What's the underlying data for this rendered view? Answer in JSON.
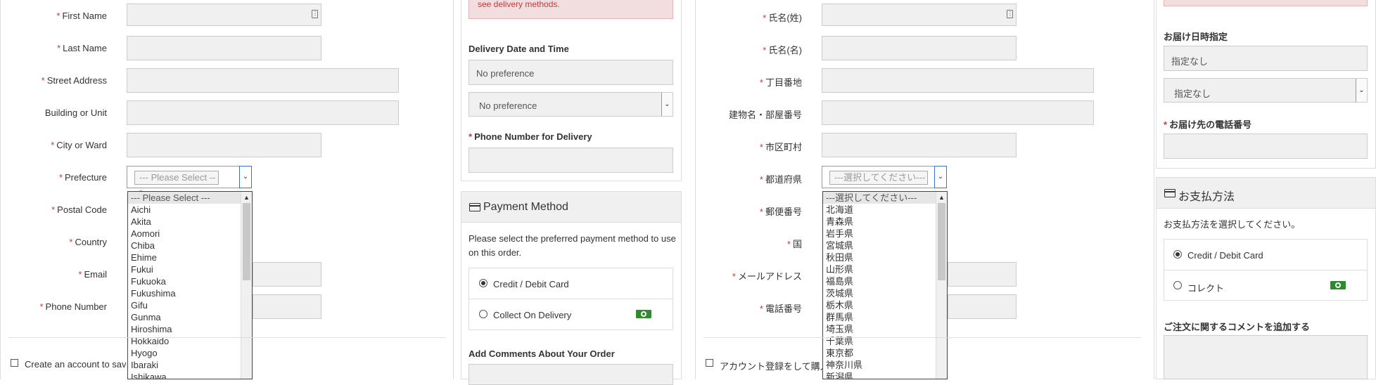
{
  "en_form": {
    "labels": {
      "first_name": "First Name",
      "last_name": "Last Name",
      "street": "Street Address",
      "building": "Building or Unit",
      "city": "City or Ward",
      "prefecture": "Prefecture",
      "postal": "Postal Code",
      "country": "Country",
      "email": "Email",
      "phone": "Phone Number"
    },
    "required_mark": "*",
    "prefecture_select": "--- Please Select ---",
    "create_account": "Create an account to sav",
    "dropdown_options": [
      "--- Please Select ---",
      "Aichi",
      "Akita",
      "Aomori",
      "Chiba",
      "Ehime",
      "Fukui",
      "Fukuoka",
      "Fukushima",
      "Gifu",
      "Gunma",
      "Hiroshima",
      "Hokkaido",
      "Hyogo",
      "Ibaraki",
      "Ishikawa"
    ]
  },
  "en_side": {
    "alert_text": "see delivery methods.",
    "delivery_date_heading": "Delivery Date and Time",
    "date_placeholder": "No preference",
    "time_select": "No preference",
    "phone_delivery_label": "Phone Number for Delivery",
    "payment_heading": "Payment Method",
    "payment_desc": "Please select the preferred payment method to use on this order.",
    "payment_options": [
      "Credit / Debit Card",
      "Collect On Delivery"
    ],
    "comments_heading": "Add Comments About Your Order"
  },
  "jp_form": {
    "labels": {
      "last_name": "氏名(姓)",
      "first_name": "氏名(名)",
      "street": "丁目番地",
      "building": "建物名・部屋番号",
      "city": "市区町村",
      "prefecture": "都道府県",
      "postal": "郵便番号",
      "country": "国",
      "email": "メールアドレス",
      "phone": "電話番号"
    },
    "required_mark": "*",
    "prefecture_select": "---選択してください---",
    "create_account": "アカウント登録をして購入",
    "dropdown_options": [
      "---選択してください---",
      "北海道",
      "青森県",
      "岩手県",
      "宮城県",
      "秋田県",
      "山形県",
      "福島県",
      "茨城県",
      "栃木県",
      "群馬県",
      "埼玉県",
      "千葉県",
      "東京都",
      "神奈川県",
      "新潟県"
    ]
  },
  "jp_side": {
    "delivery_date_heading": "お届け日時指定",
    "date_placeholder": "指定なし",
    "time_select": "指定なし",
    "phone_delivery_label": "お届け先の電話番号",
    "payment_heading": "お支払方法",
    "payment_desc": "お支払方法を選択してください。",
    "payment_options": [
      "Credit / Debit Card",
      "コレクト"
    ],
    "comments_heading": "ご注文に関するコメントを追加する"
  }
}
